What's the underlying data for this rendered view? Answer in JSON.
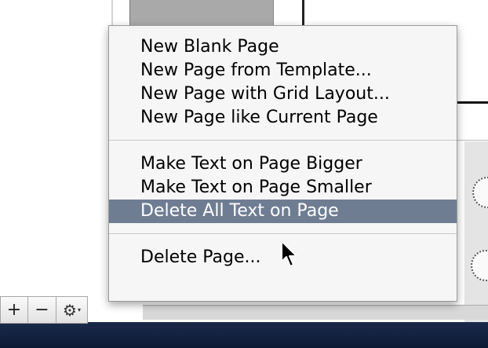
{
  "toolbar": {
    "add_label": "+",
    "remove_label": "−",
    "gear_glyph": "⚙",
    "caret_glyph": "▾"
  },
  "menu": {
    "group1": [
      {
        "label": "New Blank Page"
      },
      {
        "label": "New Page from Template..."
      },
      {
        "label": "New Page with Grid Layout..."
      },
      {
        "label": "New Page like Current Page"
      }
    ],
    "group2": [
      {
        "label": "Make Text on Page Bigger"
      },
      {
        "label": "Make Text on Page Smaller"
      },
      {
        "label": "Delete All Text on Page",
        "highlighted": true
      }
    ],
    "group3": [
      {
        "label": "Delete Page..."
      }
    ]
  },
  "colors": {
    "highlight": "#6f7d93",
    "status_bar": "#13223f"
  },
  "icons": [
    "plus-icon",
    "minus-icon",
    "gear-icon",
    "arrow-cursor-icon"
  ]
}
